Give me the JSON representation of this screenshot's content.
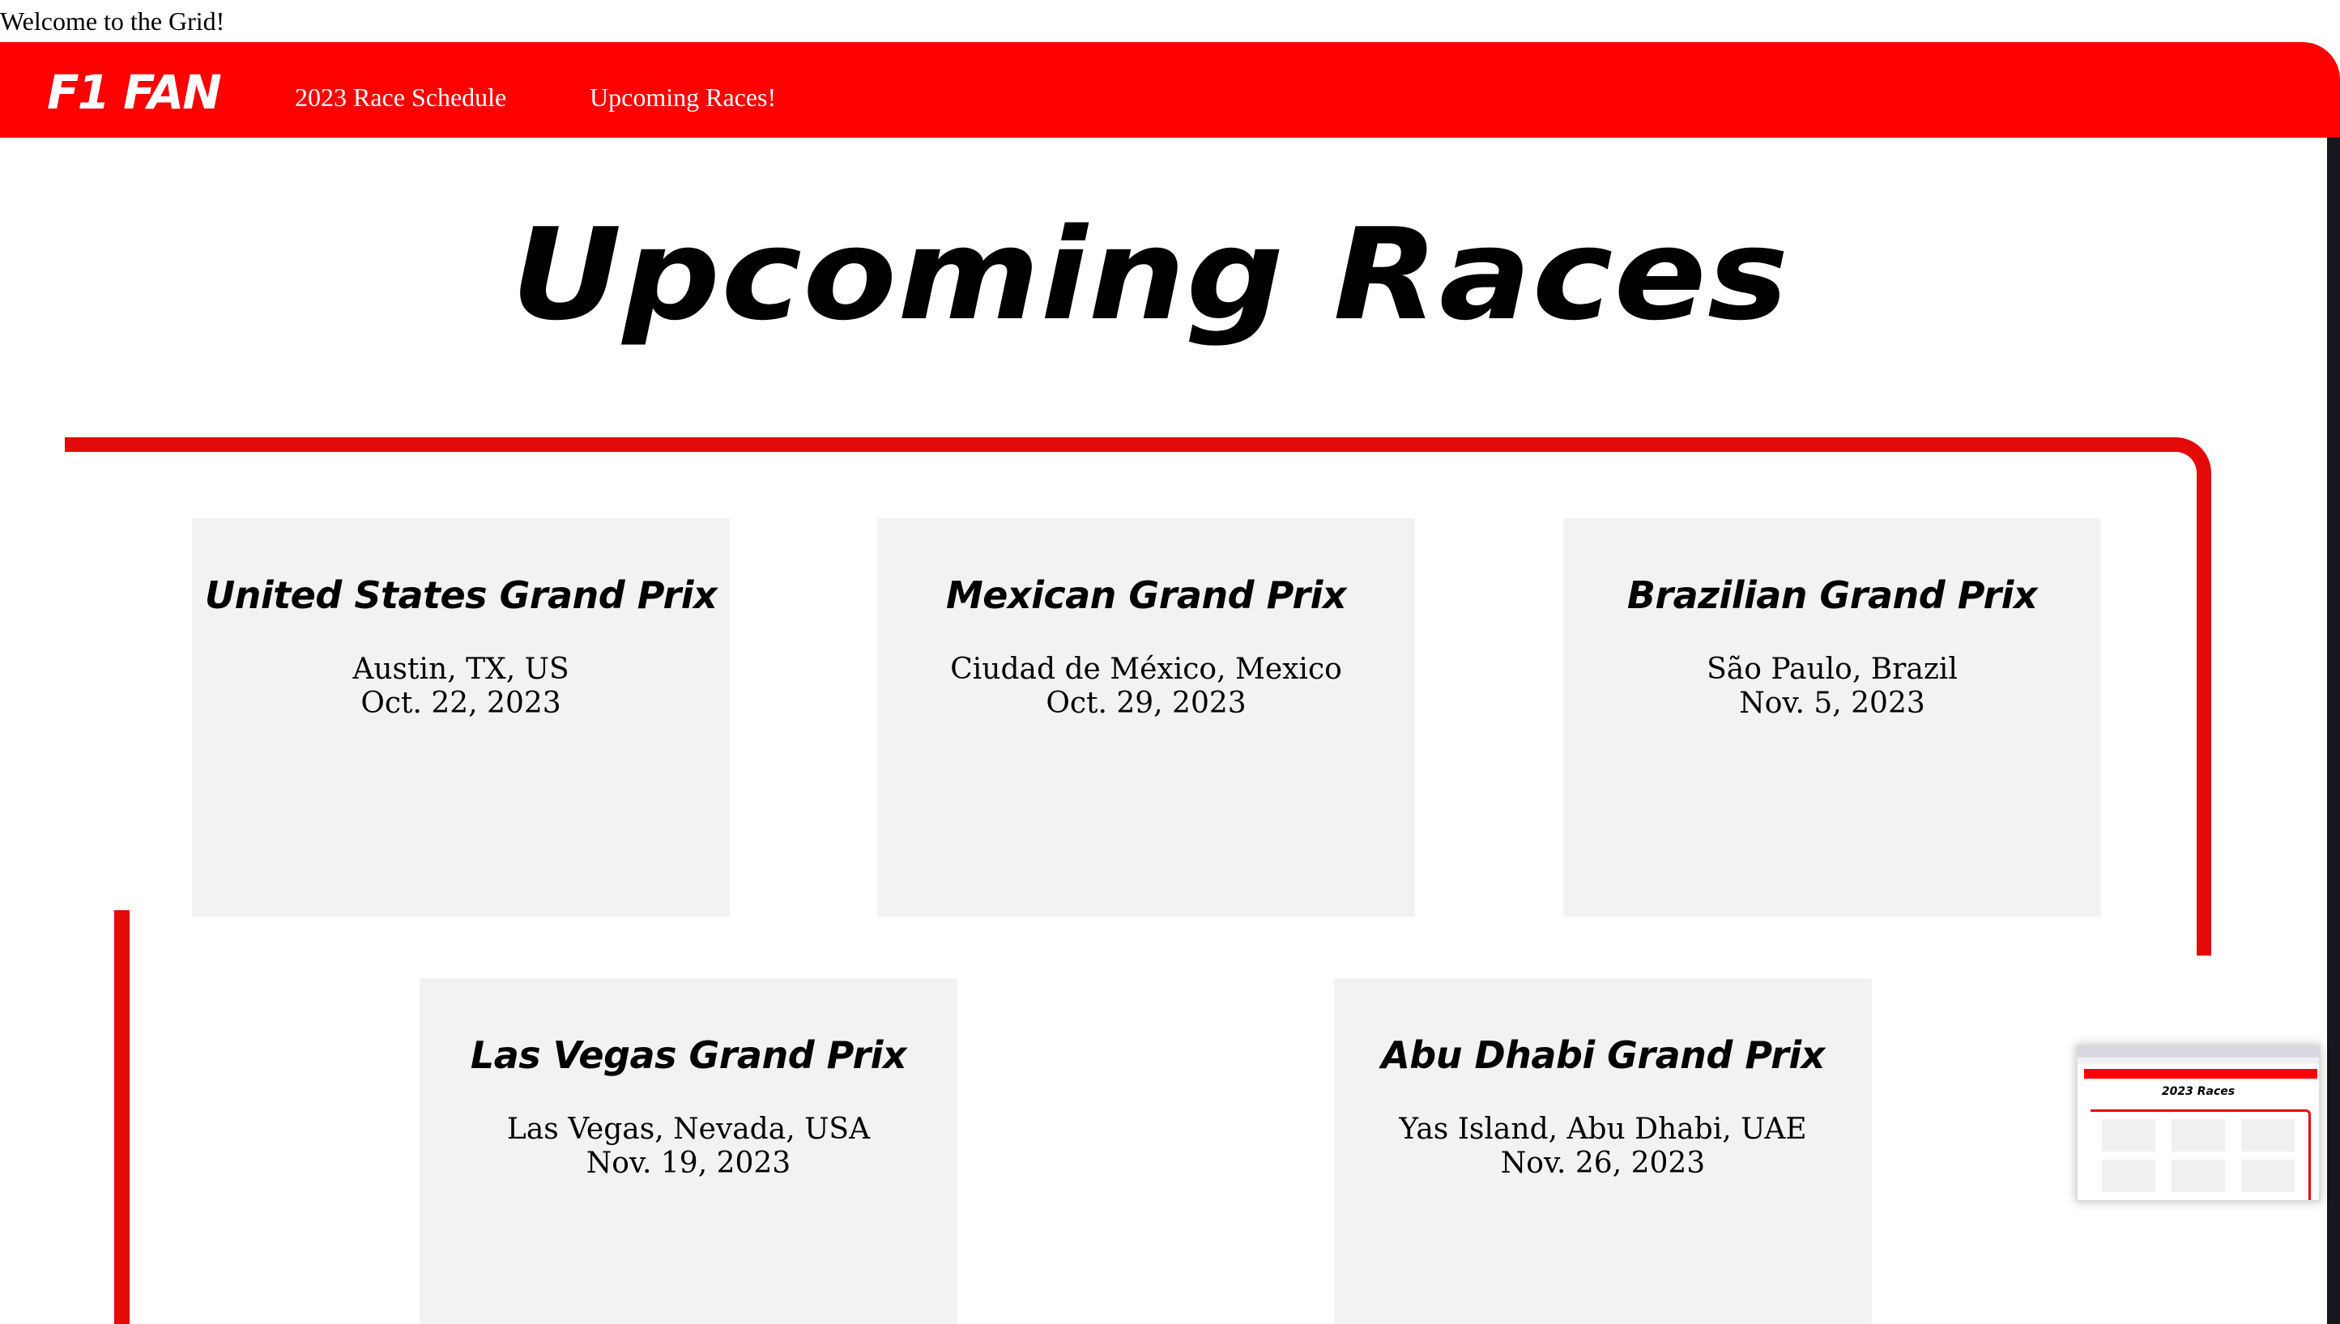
{
  "welcome_text": "Welcome to the Grid!",
  "nav": {
    "logo": "F1 FAN",
    "links": [
      "2023 Race Schedule",
      "Upcoming Races!"
    ]
  },
  "page_title": "Upcoming Races",
  "races": [
    {
      "name": "United States Grand Prix",
      "location": "Austin, TX, US",
      "date": "Oct. 22, 2023"
    },
    {
      "name": "Mexican Grand Prix",
      "location": "Ciudad de México, Mexico",
      "date": "Oct. 29, 2023"
    },
    {
      "name": "Brazilian Grand Prix",
      "location": "São Paulo, Brazil",
      "date": "Nov. 5, 2023"
    },
    {
      "name": "Las Vegas Grand Prix",
      "location": "Las Vegas, Nevada, USA",
      "date": "Nov. 19, 2023"
    },
    {
      "name": "Abu Dhabi Grand Prix",
      "location": "Yas Island, Abu Dhabi, UAE",
      "date": "Nov. 26, 2023"
    }
  ],
  "thumbnail": {
    "title": "2023 Races"
  },
  "colors": {
    "nav_red": "#ff0000",
    "track_red": "#e30a0a",
    "frame_dark": "#17161c",
    "card_bg": "#f2f2f2"
  }
}
